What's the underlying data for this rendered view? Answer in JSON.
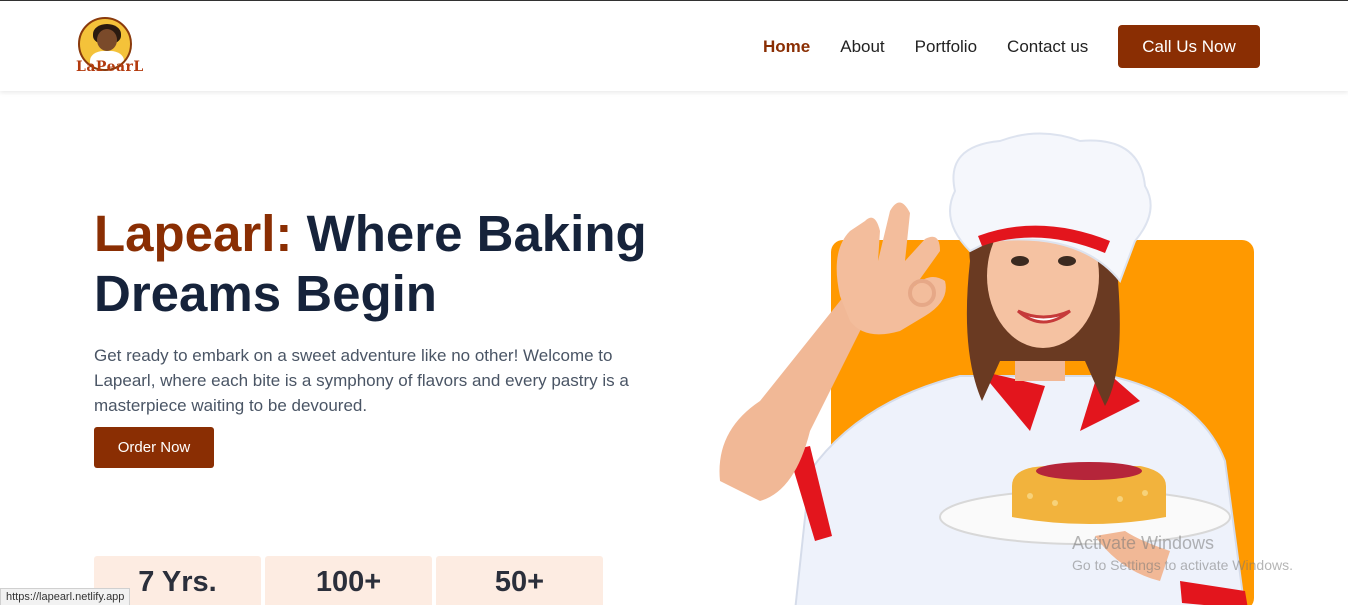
{
  "logo": {
    "text": "LaPearL"
  },
  "nav": {
    "links": [
      "Home",
      "About",
      "Portfolio",
      "Contact us"
    ],
    "cta": "Call Us Now"
  },
  "hero": {
    "title_brand": "Lapearl:",
    "title_rest": " Where Baking Dreams Begin",
    "description": "Get ready to embark on a sweet adventure like no other! Welcome to Lapearl, where each bite is a symphony of flavors and every pastry is a masterpiece waiting to be devoured.",
    "order_button": "Order Now"
  },
  "stats": [
    "7 Yrs.",
    "100+",
    "50+"
  ],
  "status_bar": {
    "url": "https://lapearl.netlify.app"
  },
  "watermark": {
    "line1": "Activate Windows",
    "line2": "Go to Settings to activate Windows."
  },
  "colors": {
    "brand": "#8a2e03",
    "title": "#16233b",
    "accent_panel": "#ff9900",
    "stat_bg": "#fdece2"
  },
  "icons": {
    "hero_image": "chef-with-cake-illustration",
    "logo": "baker-logo"
  }
}
